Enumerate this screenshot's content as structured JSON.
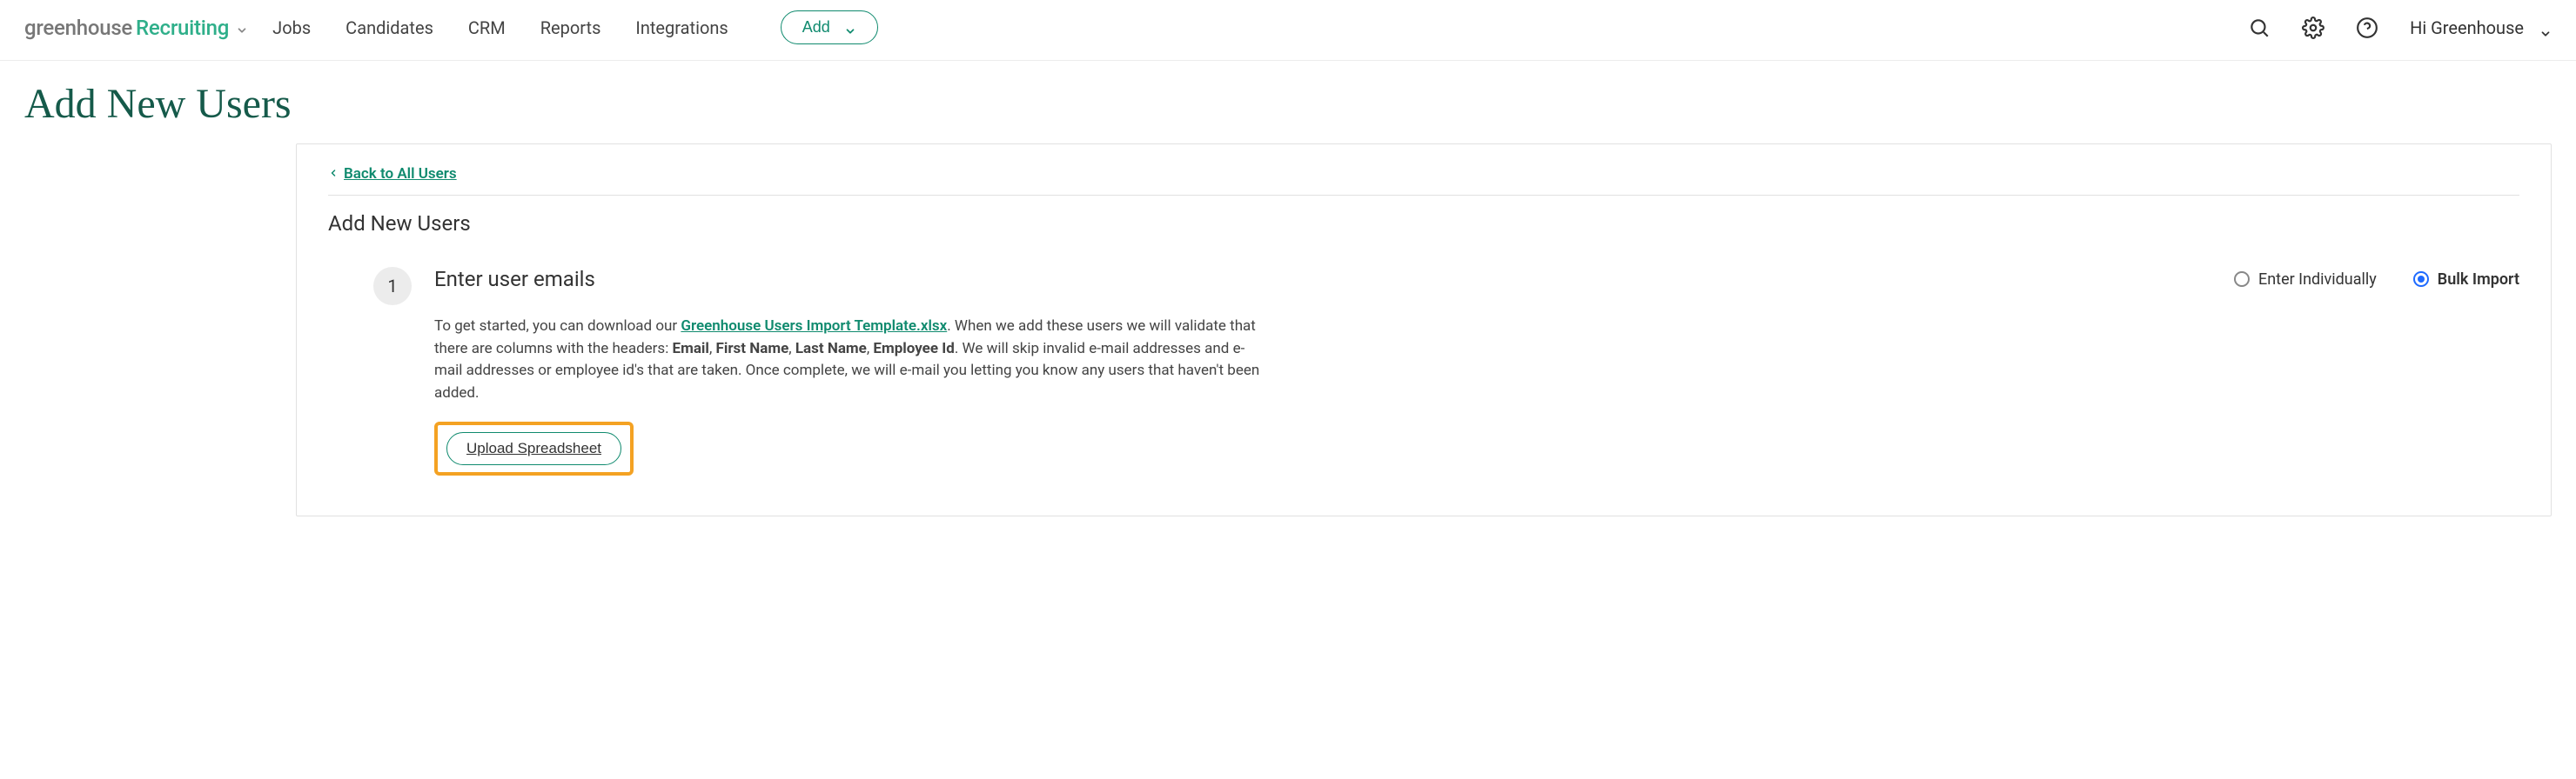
{
  "brand": {
    "part1": "greenhouse",
    "part2": "Recruiting"
  },
  "nav": {
    "items": [
      "Jobs",
      "Candidates",
      "CRM",
      "Reports",
      "Integrations"
    ],
    "add_label": "Add"
  },
  "user": {
    "greeting": "Hi Greenhouse"
  },
  "page": {
    "title": "Add New Users",
    "back_label": "Back to All Users",
    "subtitle": "Add New Users"
  },
  "step": {
    "number": "1",
    "title": "Enter user emails",
    "options": {
      "individual": "Enter Individually",
      "bulk": "Bulk Import",
      "selected": "bulk"
    },
    "desc": {
      "pre": "To get started, you can download our ",
      "template_link": "Greenhouse Users Import Template.xlsx",
      "mid1": ". When we add these users we will validate that there are columns with the headers: ",
      "h_email": "Email",
      "sep": ", ",
      "h_first": "First Name",
      "h_last": "Last Name",
      "h_emp": "Employee Id",
      "mid2": ". We will skip invalid e-mail addresses and e-mail addresses or employee id's that are taken. Once complete, we will e-mail you letting you know any users that haven't been added."
    },
    "upload_label": "Upload Spreadsheet"
  }
}
